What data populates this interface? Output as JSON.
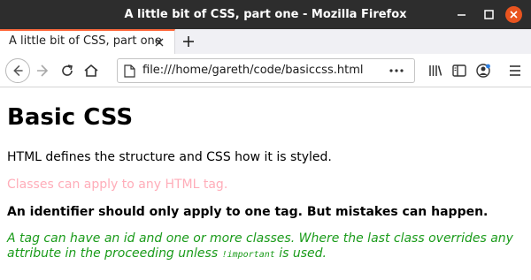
{
  "window": {
    "title": "A little bit of CSS, part one - Mozilla Firefox",
    "colors": {
      "titlebar": "#2d2d2d",
      "close_button": "#e9541f",
      "tab_accent": "#ff6a3d"
    }
  },
  "tabs": [
    {
      "label": "A little bit of CSS, part one",
      "active": true
    }
  ],
  "navbar": {
    "url": "file:///home/gareth/code/basiccss.html",
    "icons": [
      "back-icon",
      "forward-icon",
      "reload-icon",
      "home-icon",
      "page-icon",
      "more-icon",
      "library-icon",
      "sidebar-icon",
      "account-icon",
      "menu-icon"
    ]
  },
  "page": {
    "heading": "Basic CSS",
    "p1": "HTML defines the structure and CSS how it is styled.",
    "p2": "Classes can apply to any HTML tag.",
    "p3": "An identifier should only apply to one tag. But mistakes can happen.",
    "p4_before": "A tag can have an id and one or more classes. Where the last class overrides any attribute in the proceeding unless ",
    "p4_code": "!important",
    "p4_after": " is used.",
    "colors": {
      "pink_text": "#ffadb9",
      "green_text": "#1a9b1a"
    }
  }
}
